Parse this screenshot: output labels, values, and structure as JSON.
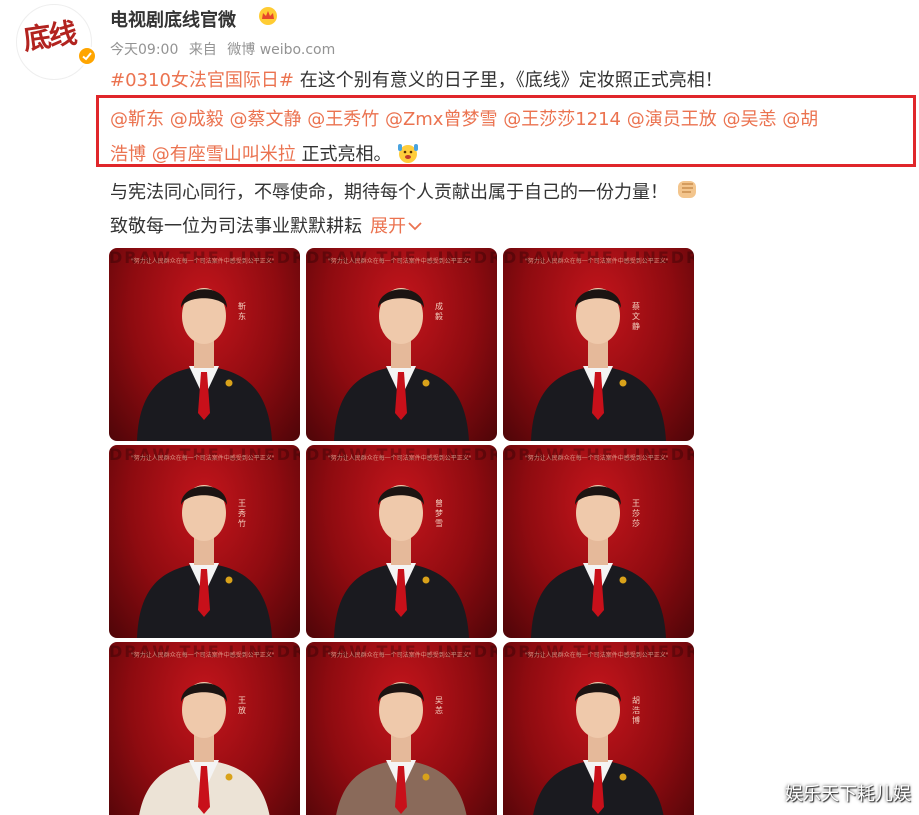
{
  "header": {
    "username": "电视剧底线官微",
    "time": "今天09:00",
    "source_prefix": "来自",
    "source": "微博 weibo.com",
    "avatar_text": "底线"
  },
  "post": {
    "hashtag": "#0310女法官国际日#",
    "line1_text": " 在这个别有意义的日子里，《底线》定妆照正式亮相！",
    "mentions_line1": [
      "@靳东",
      "@成毅",
      "@蔡文静",
      "@王秀竹",
      "@Zmx曾梦雪",
      "@王莎莎1214",
      "@演员王放",
      "@吴恙",
      "@胡"
    ],
    "mentions_line2": [
      "浩博",
      "@有座雪山叫米拉"
    ],
    "line2_suffix": " 正式亮相。",
    "line3": "与宪法同心同行，不辱使命，期待每个人贡献出属于自己的一份力量！",
    "line4": "致敬每一位为司法事业默默耕耘",
    "expand_label": "展开"
  },
  "photos": [
    {
      "name": "靳东"
    },
    {
      "name": "成毅"
    },
    {
      "name": "蔡文静"
    },
    {
      "name": "王秀竹"
    },
    {
      "name": "曾梦雪"
    },
    {
      "name": "王莎莎"
    },
    {
      "name": "王放"
    },
    {
      "name": "吴恙"
    },
    {
      "name": "胡浩博"
    }
  ],
  "photo_band_text": "DRAW THE LINEDRAW THE LINE",
  "photo_quote_text": "\"努力让人民群众在每一个司法案件中感受到公平正义\"",
  "watermark": "娱乐天下耗儿娱",
  "colors": {
    "accent": "#eb7350",
    "highlight_border": "#e0262a",
    "photo_bg": "#a8111a"
  }
}
